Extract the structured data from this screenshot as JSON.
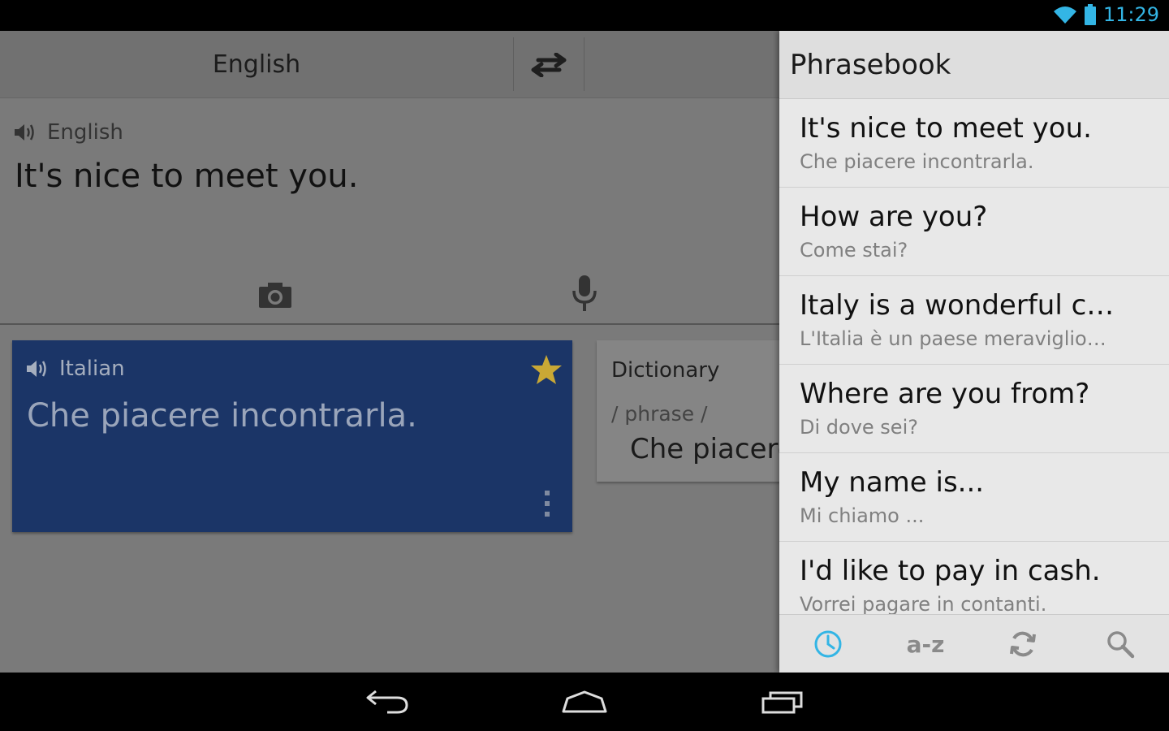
{
  "status_bar": {
    "time": "11:29",
    "icons": [
      "wifi-icon",
      "battery-icon"
    ],
    "accent_color": "#33b5e5"
  },
  "translate": {
    "source_language": "English",
    "swap_icon": "swap-arrows-icon",
    "input": {
      "language": "English",
      "text": "It's nice to meet you."
    },
    "input_tools": [
      "camera-icon",
      "microphone-icon"
    ],
    "result": {
      "language": "Italian",
      "text": "Che piacere incontrarla.",
      "starred": true,
      "card_color": "#1b3567",
      "star_color": "#c9a835"
    },
    "dictionary": {
      "title": "Dictionary",
      "part_of_speech": "/ phrase /",
      "entry": "Che piacere incontrarla."
    }
  },
  "phrasebook": {
    "title": "Phrasebook",
    "items": [
      {
        "source": "It's nice to meet you.",
        "translation": "Che piacere incontrarla."
      },
      {
        "source": "How are you?",
        "translation": "Come stai?"
      },
      {
        "source": "Italy is a wonderful c…",
        "translation": "L'Italia è un paese meraviglio…"
      },
      {
        "source": "Where are you from?",
        "translation": "Di dove sei?"
      },
      {
        "source": "My name is...",
        "translation": "Mi chiamo ..."
      },
      {
        "source": "I'd like to pay in cash.",
        "translation": "Vorrei pagare in contanti."
      }
    ],
    "toolbar": {
      "recent_icon": "clock-icon",
      "az_label": "a-z",
      "sync_icon": "sync-icon",
      "search_icon": "search-icon",
      "active_color": "#33b5e5"
    }
  },
  "nav_bar": {
    "buttons": [
      "back-icon",
      "home-icon",
      "recent-apps-icon"
    ]
  }
}
